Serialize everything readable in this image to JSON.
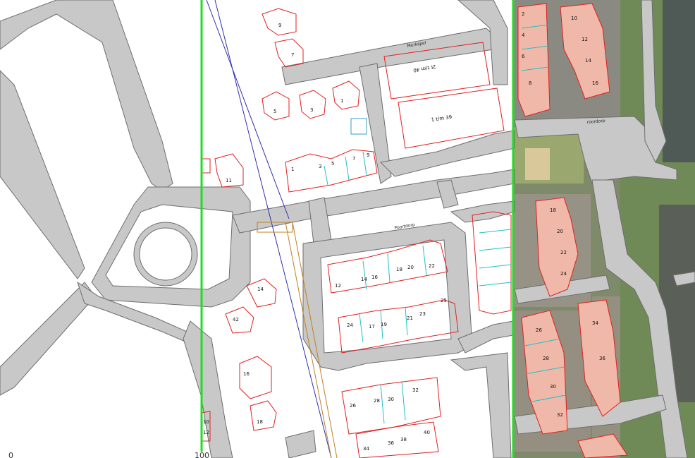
{
  "map": {
    "street_labels": [
      "Merkspel",
      "Poortdorp",
      "Poortdorp",
      "roordorp"
    ],
    "house_numbers_center": [
      "1",
      "3",
      "5",
      "7",
      "9",
      "11",
      "9",
      "7",
      "5",
      "3",
      "1",
      "12",
      "14",
      "16",
      "18",
      "20",
      "22",
      "24",
      "17",
      "19",
      "21",
      "23",
      "25",
      "26",
      "28",
      "30",
      "32",
      "34",
      "36",
      "38",
      "40",
      "42",
      "14",
      "16",
      "18",
      "10",
      "12"
    ],
    "complex_labels": [
      "2t t/m 40",
      "1 t/m 39"
    ],
    "house_numbers_east": [
      "2",
      "4",
      "6",
      "8",
      "10",
      "12",
      "14",
      "16",
      "18",
      "20",
      "22",
      "24",
      "26",
      "28",
      "30",
      "32",
      "34",
      "36"
    ],
    "scale_labels": [
      "0",
      "100"
    ],
    "colors": {
      "road_fill": "#c8c8c8",
      "road_outline": "#6e6e6e",
      "building_outline": "#e02020",
      "parcel_divider": "#20c0c8",
      "grid_line": "#22dd22",
      "canal_line": "#3030b0",
      "path_line": "#c08020"
    }
  }
}
